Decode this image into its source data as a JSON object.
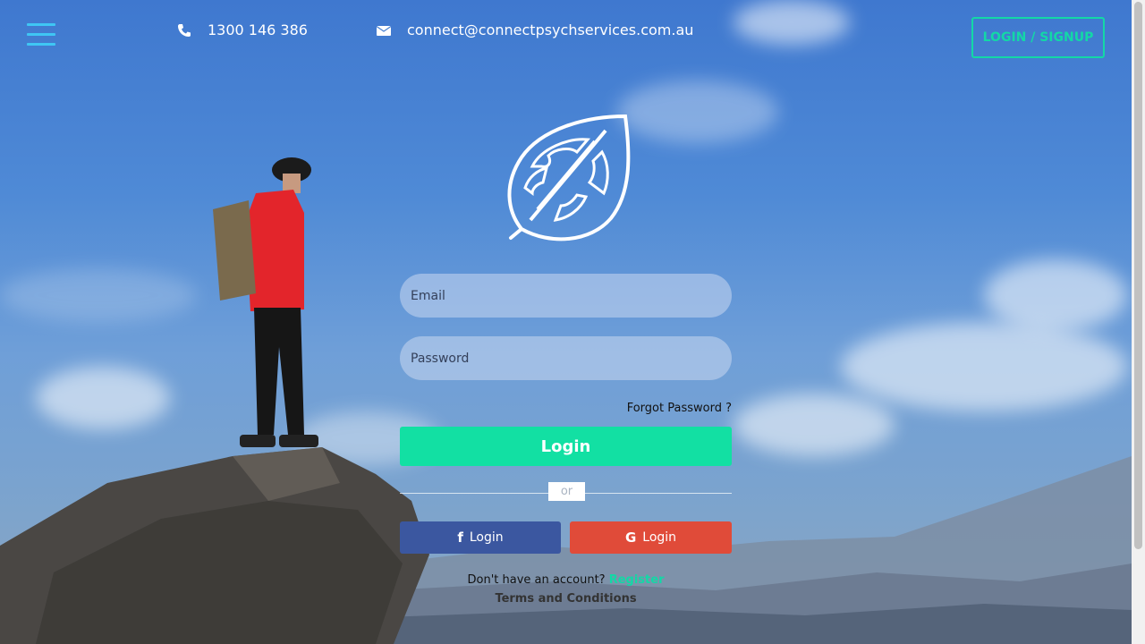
{
  "header": {
    "menu_icon": "hamburger-menu-icon",
    "phone": {
      "icon": "phone-icon",
      "text": "1300 146 386"
    },
    "email": {
      "icon": "envelope-icon",
      "text": "connect@connectpsychservices.com.au"
    },
    "login_signup_label": "LOGIN / SIGNUP"
  },
  "logo": {
    "icon": "leaf-logo-icon"
  },
  "form": {
    "email_placeholder": "Email",
    "password_placeholder": "Password",
    "forgot_label": "Forgot Password ?",
    "login_label": "Login",
    "or_label": "or",
    "facebook_label": "Login",
    "google_label": "Login",
    "no_account_text": "Don't have an account?",
    "register_label": "Register",
    "terms_label": "Terms and Conditions"
  },
  "colors": {
    "accent": "#13d8a6",
    "facebook": "#3b57a0",
    "google": "#e04b39",
    "menu_icon": "#3fc6f4"
  }
}
